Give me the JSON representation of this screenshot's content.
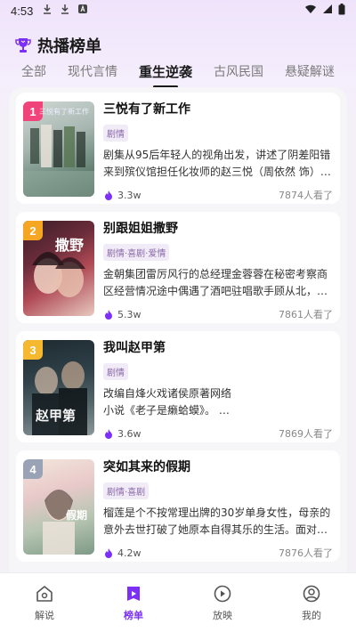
{
  "status_bar": {
    "time": "4:53",
    "icons": [
      "download-icon",
      "download-icon",
      "a-icon"
    ],
    "right_icons": [
      "wifi-icon",
      "signal-icon",
      "battery-icon"
    ]
  },
  "header": {
    "title": "热播榜单",
    "icon": "trophy-icon"
  },
  "tabs": [
    {
      "label": "全部",
      "active": false
    },
    {
      "label": "现代言情",
      "active": false
    },
    {
      "label": "重生逆袭",
      "active": true
    },
    {
      "label": "古风民国",
      "active": false
    },
    {
      "label": "悬疑解谜",
      "active": false
    }
  ],
  "dramas": [
    {
      "rank": "1",
      "rank_color": "#f0447a",
      "title": "三悦有了新工作",
      "tag": "剧情",
      "description": "剧集从95后年轻人的视角出发，讲述了阴差阳错来到殡仪馆担任化妆师的赵三悦（周依然 饰）…",
      "heat": "3.3w",
      "views": "7874人看了",
      "poster_text": "三悦有了新工作"
    },
    {
      "rank": "2",
      "rank_color": "#f5a623",
      "title": "别跟姐姐撒野",
      "tag": "剧情·喜剧·爱情",
      "description": "金朝集团雷厉风行的总经理金蓉蓉在秘密考察商区经营情况途中偶遇了酒吧驻唱歌手顾从北，…",
      "heat": "5.3w",
      "views": "7861人看了",
      "poster_text": "撒野"
    },
    {
      "rank": "3",
      "rank_color": "#f5b82e",
      "title": "我叫赵甲第",
      "tag": "剧情",
      "description": "改编自烽火戏诸侯原著网络\n小说《老子是癞蛤蟆》。 …",
      "heat": "3.6w",
      "views": "7869人看了",
      "poster_text": "赵甲第"
    },
    {
      "rank": "4",
      "rank_color": "#9aa3b5",
      "title": "突如其来的假期",
      "tag": "剧情·喜剧",
      "description": "榴莲是个不按常理出牌的30岁单身女性，母亲的意外去世打破了她原本自得其乐的生活。面对…",
      "heat": "4.2w",
      "views": "7876人看了",
      "poster_text": "假期"
    }
  ],
  "bottom_nav": [
    {
      "label": "解说",
      "icon": "home-icon",
      "active": false
    },
    {
      "label": "榜单",
      "icon": "ranking-icon",
      "active": true
    },
    {
      "label": "放映",
      "icon": "play-icon",
      "active": false
    },
    {
      "label": "我的",
      "icon": "user-icon",
      "active": false
    }
  ],
  "colors": {
    "accent": "#7b2ff7",
    "tag_text": "#8a6aa8",
    "tag_bg": "#f1ebf7"
  }
}
